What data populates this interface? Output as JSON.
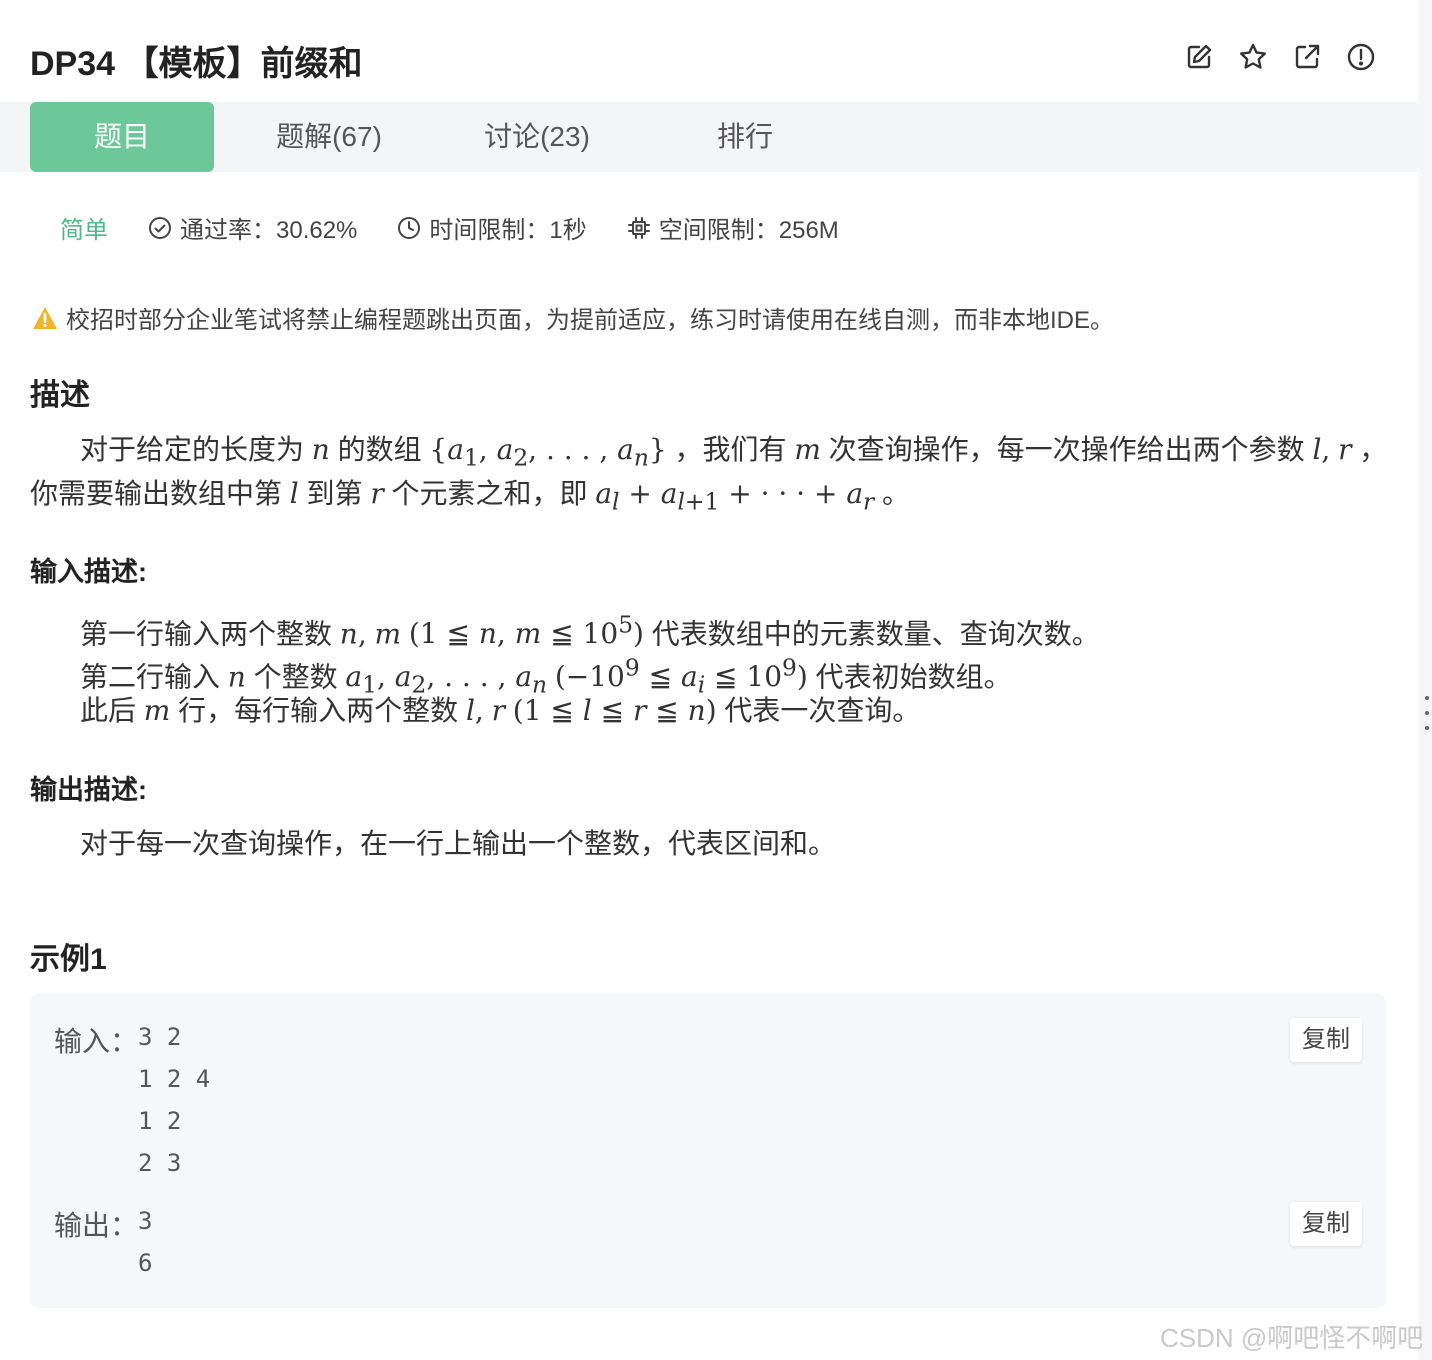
{
  "problem": {
    "title": "DP34 【模板】前缀和"
  },
  "toolbar": {
    "icons": [
      "edit-icon",
      "star-icon",
      "share-icon",
      "report-icon"
    ]
  },
  "tabs": [
    {
      "label": "题目",
      "active": true
    },
    {
      "label": "题解(67)"
    },
    {
      "label": "讨论(23)"
    },
    {
      "label": "排行"
    }
  ],
  "meta": {
    "difficulty": "简单",
    "pass_rate": "通过率：30.62%",
    "time_limit": "时间限制：1秒",
    "space_limit": "空间限制：256M"
  },
  "warning": "校招时部分企业笔试将禁止编程题跳出页面，为提前适应，练习时请使用在线自测，而非本地IDE。",
  "description": {
    "heading": "描述",
    "line1_a": "对于给定的长度为",
    "line1_b": "的数组",
    "line1_c": "，我们有",
    "line1_d": "次查询操作，每一次操作给出两个参数",
    "line2_a": "你需要输出数组中第",
    "line2_b": "到第",
    "line2_c": "个元素之和，即",
    "line2_d": "。"
  },
  "input_desc": {
    "heading": "输入描述:",
    "l1_a": "第一行输入两个整数",
    "l1_b": "代表数组中的元素数量、查询次数。",
    "l2_a": "第二行输入",
    "l2_b": "个整数",
    "l2_c": "代表初始数组。",
    "l3_a": "此后",
    "l3_b": "行，每行输入两个整数",
    "l3_c": "代表一次查询。"
  },
  "output_desc": {
    "heading": "输出描述:",
    "text": "对于每一次查询操作，在一行上输出一个整数，代表区间和。"
  },
  "example": {
    "heading": "示例1",
    "input_label": "输入：",
    "input_lines": [
      "3 2",
      "1 2 4",
      "1 2",
      "2 3"
    ],
    "output_label": "输出：",
    "output_lines": [
      "3",
      "6"
    ],
    "copy_label": "复制"
  },
  "watermark": "CSDN @啊吧怪不啊吧"
}
